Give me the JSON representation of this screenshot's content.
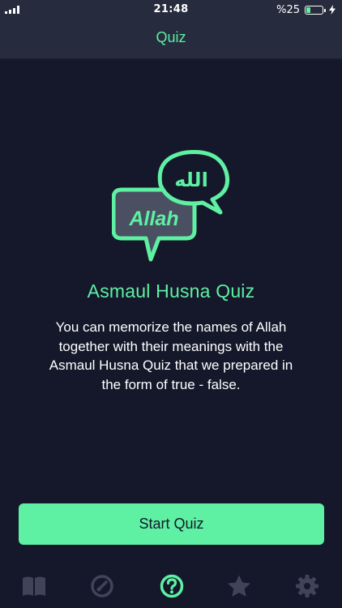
{
  "status_bar": {
    "time": "21:48",
    "battery_percent": "%25",
    "battery_level": 0.25,
    "icons": [
      "signal-icon",
      "battery-icon",
      "charging-icon"
    ]
  },
  "header": {
    "title": "Quiz"
  },
  "hero": {
    "latin_text": "Allah",
    "arabic_text": "الله"
  },
  "content": {
    "title": "Asmaul Husna Quiz",
    "description": "You can memorize the names of Allah together with their meanings with the Asmaul Husna Quiz that we prepared in the form of true - false."
  },
  "actions": {
    "start_label": "Start Quiz"
  },
  "tab_bar": {
    "tabs": [
      {
        "icon": "book-icon",
        "active": false
      },
      {
        "icon": "dhikr-counter-icon",
        "active": false
      },
      {
        "icon": "question-icon",
        "active": true
      },
      {
        "icon": "star-icon",
        "active": false
      },
      {
        "icon": "gear-icon",
        "active": false
      }
    ]
  },
  "colors": {
    "accent": "#5ef0a3",
    "background": "#14182a",
    "header": "#262b3d",
    "inactive_icon": "#3f4459",
    "bubble_fill": "#4a4f62",
    "text": "#ffffff"
  }
}
